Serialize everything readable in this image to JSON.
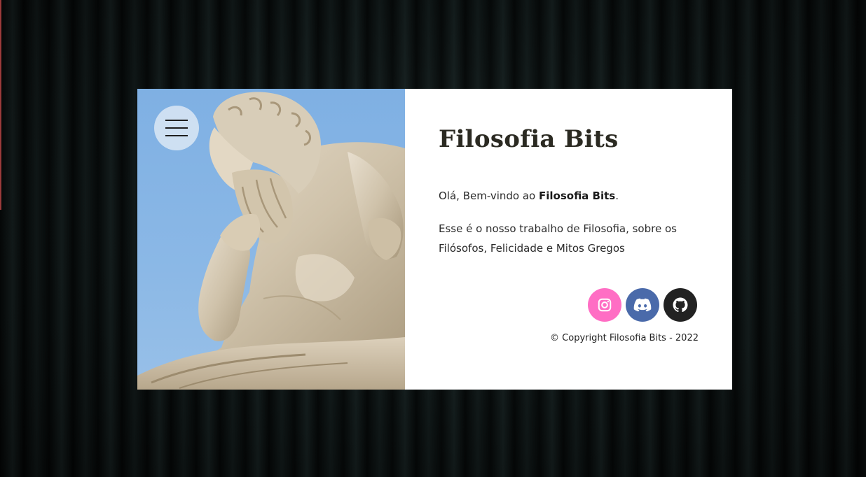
{
  "header": {
    "title": "Filosofia Bits"
  },
  "intro": {
    "greeting_prefix": "Olá, Bem-vindo ao ",
    "greeting_brand": "Filosofia Bits",
    "greeting_suffix": ".",
    "description": "Esse é o nosso trabalho de Filosofia, sobre os Filósofos, Felicidade e Mitos Gregos"
  },
  "socials": [
    {
      "name": "instagram",
      "icon": "instagram-icon",
      "color": "#ff6ec4"
    },
    {
      "name": "discord",
      "icon": "discord-icon",
      "color": "#4a6aaa"
    },
    {
      "name": "github",
      "icon": "github-icon",
      "color": "#222222"
    }
  ],
  "footer": {
    "copyright": "© Copyright Filosofia Bits - 2022"
  },
  "image": {
    "subject": "statue-icon"
  }
}
